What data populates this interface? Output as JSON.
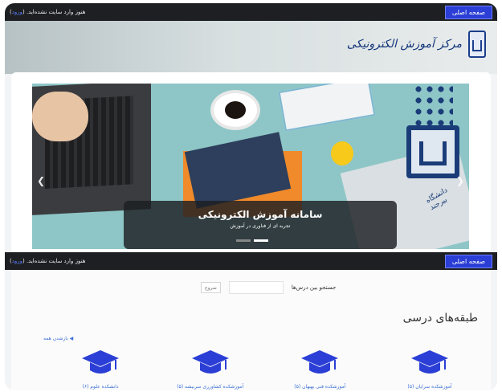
{
  "topbar": {
    "home_label": "صفحه اصلی",
    "login_text": "هنوز وارد سایت نشده‌اید. (",
    "login_link": "ورود",
    "login_close": ")"
  },
  "header": {
    "brand_name": "مرکز آموزش الکترونیکی"
  },
  "slider": {
    "title": "سامانه آموزش الکترونیکی",
    "subtitle": "تجربه ای از فناوری در آموزش",
    "university_caption": "دانشگاه بیرجند",
    "slide_count": 2,
    "active_slide": 2
  },
  "search": {
    "label": "جستجو بین درس‌ها",
    "placeholder": "",
    "button": "شروع"
  },
  "categories": {
    "title": "طبقه‌های درسی",
    "collapse_label": "بازشدن همه",
    "items": [
      {
        "label": "آموزشکده سرایان (۵)"
      },
      {
        "label": "آموزشکده فنی بهبهان (۵)"
      },
      {
        "label": "آموزشکده کشاورزی سربیشه (۵)"
      },
      {
        "label": "دانشکده علوم (۶)"
      }
    ]
  },
  "colors": {
    "topbar_bg": "#1e1f22",
    "home_button": "#2b3fd6",
    "link": "#3b6fd6",
    "brand_navy": "#1a3c78"
  }
}
